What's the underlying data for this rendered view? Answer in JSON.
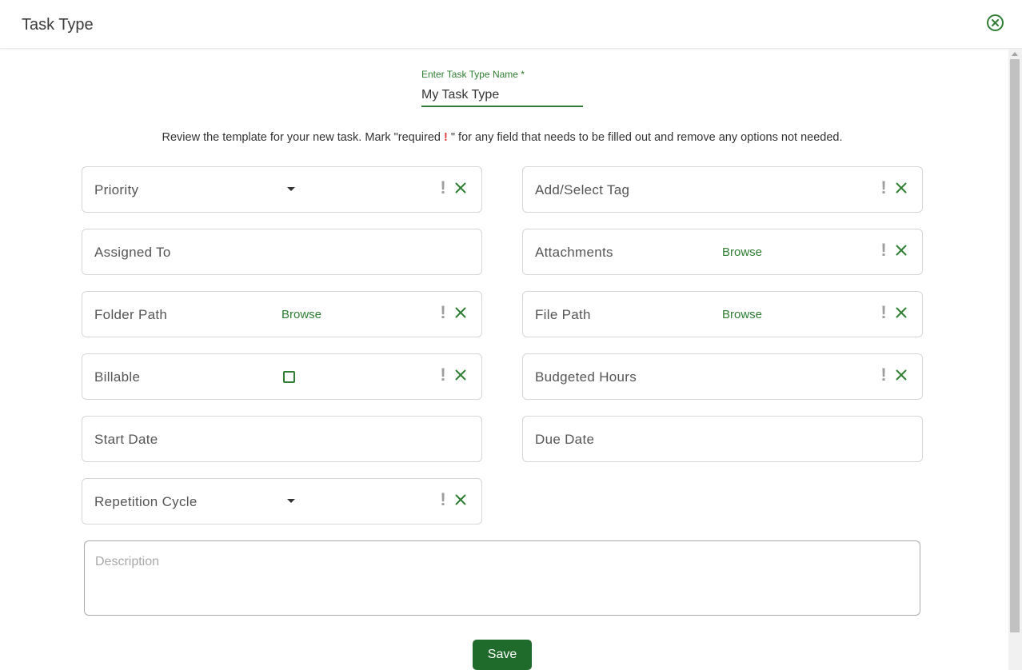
{
  "header": {
    "title": "Task Type"
  },
  "name_field": {
    "label": "Enter Task Type Name *",
    "value": "My Task Type"
  },
  "instructions": {
    "before": "Review the template for your new task. Mark \"required ",
    "mark": "!",
    "after": " \" for any field that needs to be filled out and remove any options not needed."
  },
  "fields": {
    "priority": {
      "label": "Priority"
    },
    "assigned_to": {
      "label": "Assigned To"
    },
    "folder_path": {
      "label": "Folder Path",
      "browse": "Browse"
    },
    "billable": {
      "label": "Billable"
    },
    "start_date": {
      "label": "Start Date"
    },
    "repetition_cycle": {
      "label": "Repetition Cycle"
    },
    "add_select_tag": {
      "label": "Add/Select Tag"
    },
    "attachments": {
      "label": "Attachments",
      "browse": "Browse"
    },
    "file_path": {
      "label": "File Path",
      "browse": "Browse"
    },
    "budgeted_hours": {
      "label": "Budgeted Hours"
    },
    "due_date": {
      "label": "Due Date"
    }
  },
  "field_controls": {
    "required_glyph": "!"
  },
  "description": {
    "placeholder": "Description"
  },
  "save": {
    "label": "Save"
  },
  "colors": {
    "accent": "#2e7d32",
    "save_bg": "#1f6b2b",
    "required": "#e53935"
  },
  "icons": {
    "close": "close-circle-icon",
    "remove": "x-icon",
    "required": "exclamation-icon",
    "dropdown": "caret-down-icon"
  }
}
